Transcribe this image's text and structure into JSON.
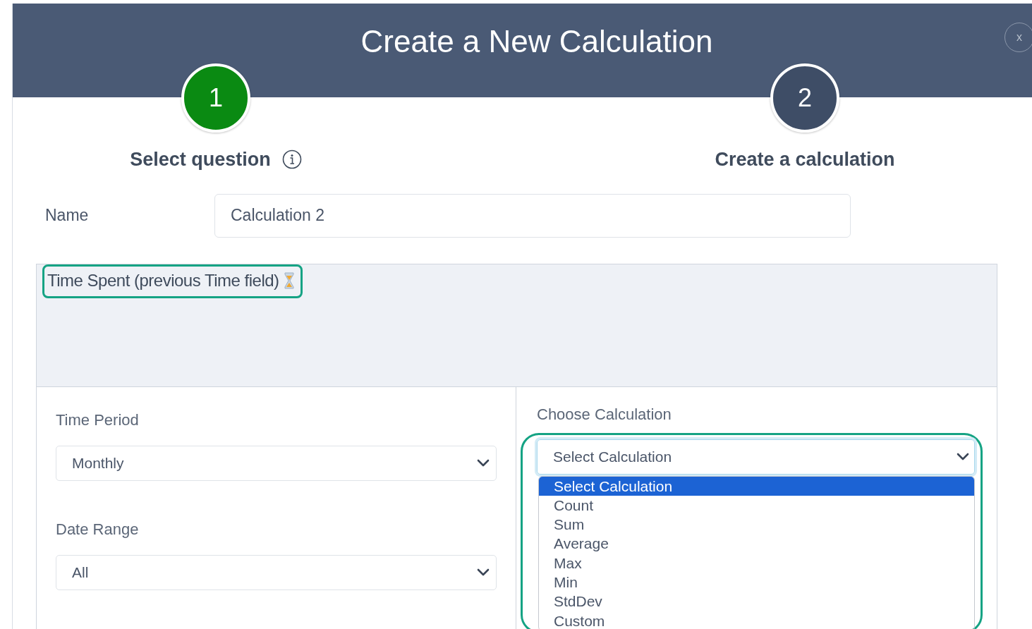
{
  "dialog": {
    "title": "Create a New Calculation",
    "close_label": "x"
  },
  "steps": [
    {
      "number": "1",
      "label": "Select question",
      "selected": true,
      "info": true
    },
    {
      "number": "2",
      "label": "Create a calculation",
      "selected": false
    }
  ],
  "name_field": {
    "label": "Name",
    "value": "Calculation 2"
  },
  "question": {
    "title": "Time Spent (previous Time field)"
  },
  "time_period": {
    "label": "Time Period",
    "value": "Monthly"
  },
  "date_range": {
    "label": "Date Range",
    "value": "All"
  },
  "calculation": {
    "label": "Choose Calculation",
    "value": "Select Calculation",
    "expanded": true,
    "options": [
      {
        "label": "Select Calculation",
        "selected": true
      },
      {
        "label": "Count",
        "selected": false
      },
      {
        "label": "Sum",
        "selected": false
      },
      {
        "label": "Average",
        "selected": false
      },
      {
        "label": "Max",
        "selected": false
      },
      {
        "label": "Min",
        "selected": false
      },
      {
        "label": "StdDev",
        "selected": false
      },
      {
        "label": "Custom",
        "selected": false
      }
    ]
  }
}
